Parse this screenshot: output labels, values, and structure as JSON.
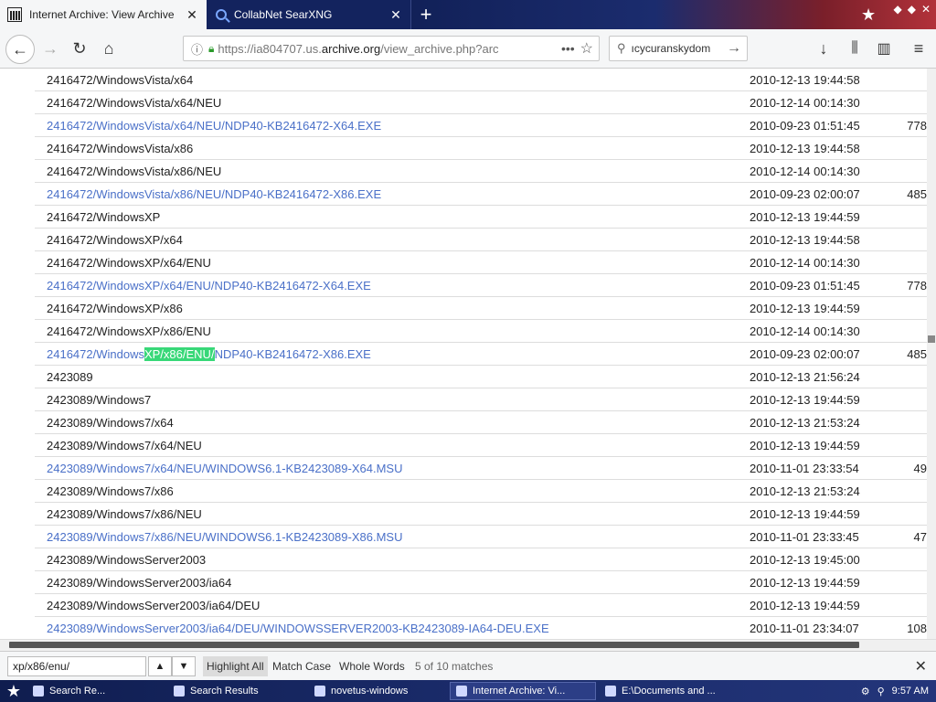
{
  "browser": {
    "tabs": [
      {
        "title": "Internet Archive: View Archive",
        "active": true,
        "icon": "archive-icon"
      },
      {
        "title": "CollabNet SearXNG",
        "active": false,
        "icon": "search-icon"
      }
    ],
    "url": {
      "prefix": "https://ia804707.us.",
      "domain": "archive.org",
      "suffix": "/view_archive.php?arc"
    },
    "search_text": "ıcycuranskydom"
  },
  "rows": [
    {
      "name": "2416472/WindowsVista/x64",
      "date": "2010-12-13 19:44:58",
      "size": "",
      "link": false
    },
    {
      "name": "2416472/WindowsVista/x64/NEU",
      "date": "2010-12-14 00:14:30",
      "size": "",
      "link": false
    },
    {
      "name": "2416472/WindowsVista/x64/NEU/NDP40-KB2416472-X64.EXE",
      "date": "2010-09-23 01:51:45",
      "size": "778",
      "link": true
    },
    {
      "name": "2416472/WindowsVista/x86",
      "date": "2010-12-13 19:44:58",
      "size": "",
      "link": false
    },
    {
      "name": "2416472/WindowsVista/x86/NEU",
      "date": "2010-12-14 00:14:30",
      "size": "",
      "link": false
    },
    {
      "name": "2416472/WindowsVista/x86/NEU/NDP40-KB2416472-X86.EXE",
      "date": "2010-09-23 02:00:07",
      "size": "485",
      "link": true
    },
    {
      "name": "2416472/WindowsXP",
      "date": "2010-12-13 19:44:59",
      "size": "",
      "link": false
    },
    {
      "name": "2416472/WindowsXP/x64",
      "date": "2010-12-13 19:44:58",
      "size": "",
      "link": false
    },
    {
      "name": "2416472/WindowsXP/x64/ENU",
      "date": "2010-12-14 00:14:30",
      "size": "",
      "link": false
    },
    {
      "name": "2416472/WindowsXP/x64/ENU/NDP40-KB2416472-X64.EXE",
      "date": "2010-09-23 01:51:45",
      "size": "778",
      "link": true
    },
    {
      "name": "2416472/WindowsXP/x86",
      "date": "2010-12-13 19:44:59",
      "size": "",
      "link": false
    },
    {
      "name": "2416472/WindowsXP/x86/ENU",
      "date": "2010-12-14 00:14:30",
      "size": "",
      "link": false
    },
    {
      "name_pre": "2416472/Windows",
      "name_hl": "XP/x86/ENU/",
      "name_post": "NDP40-KB2416472-X86.EXE",
      "date": "2010-09-23 02:00:07",
      "size": "485",
      "link": true,
      "highlighted": true
    },
    {
      "name": "2423089",
      "date": "2010-12-13 21:56:24",
      "size": "",
      "link": false
    },
    {
      "name": "2423089/Windows7",
      "date": "2010-12-13 19:44:59",
      "size": "",
      "link": false
    },
    {
      "name": "2423089/Windows7/x64",
      "date": "2010-12-13 21:53:24",
      "size": "",
      "link": false
    },
    {
      "name": "2423089/Windows7/x64/NEU",
      "date": "2010-12-13 19:44:59",
      "size": "",
      "link": false
    },
    {
      "name": "2423089/Windows7/x64/NEU/WINDOWS6.1-KB2423089-X64.MSU",
      "date": "2010-11-01 23:33:54",
      "size": "49",
      "link": true
    },
    {
      "name": "2423089/Windows7/x86",
      "date": "2010-12-13 21:53:24",
      "size": "",
      "link": false
    },
    {
      "name": "2423089/Windows7/x86/NEU",
      "date": "2010-12-13 19:44:59",
      "size": "",
      "link": false
    },
    {
      "name": "2423089/Windows7/x86/NEU/WINDOWS6.1-KB2423089-X86.MSU",
      "date": "2010-11-01 23:33:45",
      "size": "47",
      "link": true
    },
    {
      "name": "2423089/WindowsServer2003",
      "date": "2010-12-13 19:45:00",
      "size": "",
      "link": false
    },
    {
      "name": "2423089/WindowsServer2003/ia64",
      "date": "2010-12-13 19:44:59",
      "size": "",
      "link": false
    },
    {
      "name": "2423089/WindowsServer2003/ia64/DEU",
      "date": "2010-12-13 19:44:59",
      "size": "",
      "link": false
    },
    {
      "name": "2423089/WindowsServer2003/ia64/DEU/WINDOWSSERVER2003-KB2423089-IA64-DEU.EXE",
      "date": "2010-11-01 23:34:07",
      "size": "108",
      "link": true
    }
  ],
  "findbar": {
    "query": "xp/x86/enu/",
    "highlight_all": "Highlight All",
    "match_case": "Match Case",
    "whole_words": "Whole Words",
    "match_count": "5 of 10 matches"
  },
  "taskbar": {
    "tasks": [
      {
        "label": "Search Re...",
        "active": false
      },
      {
        "label": "Search Results",
        "active": false
      },
      {
        "label": "novetus-windows",
        "active": false
      },
      {
        "label": "Internet Archive: Vi...",
        "active": true
      },
      {
        "label": "E:\\Documents and ...",
        "active": false
      }
    ],
    "clock": "9:57 AM"
  },
  "colors": {
    "link": "#4a70c8",
    "highlight": "#38d878"
  }
}
